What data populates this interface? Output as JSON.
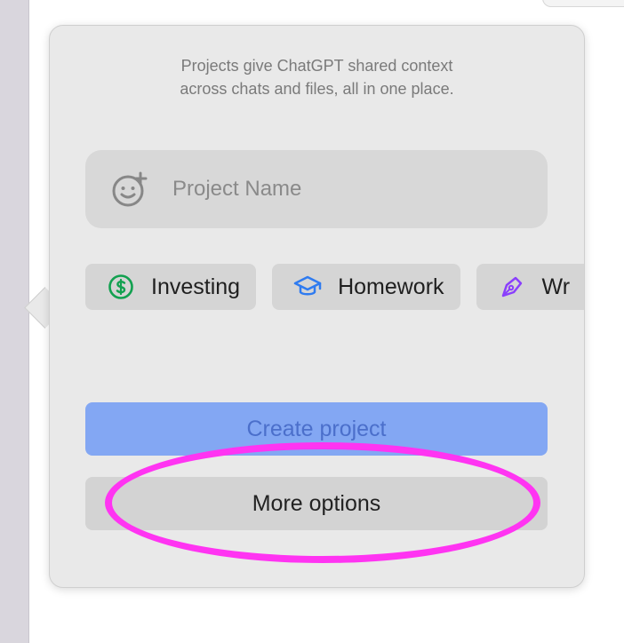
{
  "popover": {
    "description": "Projects give ChatGPT shared context\nacross chats and files, all in one place.",
    "name_placeholder": "Project Name",
    "chips": [
      {
        "label": "Investing",
        "icon": "dollar-circle-icon",
        "color": "#12a150"
      },
      {
        "label": "Homework",
        "icon": "graduation-cap-icon",
        "color": "#2f7bf0"
      },
      {
        "label": "Wr",
        "icon": "pen-nib-icon",
        "color": "#8a3ffc"
      }
    ],
    "create_label": "Create project",
    "more_label": "More options"
  },
  "colors": {
    "primary_button": "#83a7f3",
    "highlight": "#ff34f2"
  }
}
